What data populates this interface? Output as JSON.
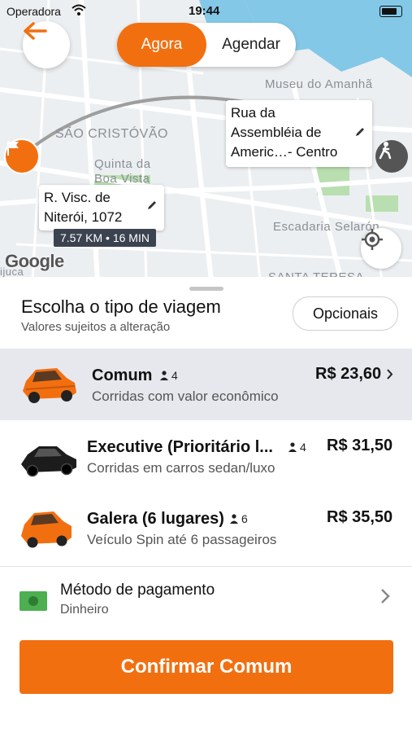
{
  "status": {
    "carrier": "Operadora",
    "time": "19:44"
  },
  "header": {
    "toggle_now": "Agora",
    "toggle_schedule": "Agendar"
  },
  "map": {
    "labels": {
      "museum": "Museu do Amanhã",
      "district": "SÃO CRISTÓVÃO",
      "quinta1": "Quinta da",
      "quinta2": "Boa Vista",
      "escadaria": "Escadaria Selarón",
      "santa_teresa": "SANTA TERESA",
      "tijuca": "ijuca"
    },
    "origin": {
      "line1": "R. Visc. de",
      "line2": "Niterói, 1072"
    },
    "destination": {
      "line1": "Rua da",
      "line2": "Assembléia de",
      "line3": "Americ…- Centro"
    },
    "eta": "7.57 KM • 16 MIN",
    "attribution": "Google"
  },
  "sheet": {
    "title": "Escolha o tipo de viagem",
    "subtitle": "Valores sujeitos a alteração",
    "options_label": "Opcionais"
  },
  "rides": [
    {
      "name": "Comum",
      "seats": "4",
      "desc": "Corridas com valor econômico",
      "price": "R$ 23,60",
      "color": "#f26f10"
    },
    {
      "name": "Executive (Prioritário l...",
      "seats": "4",
      "desc": "Corridas em carros sedan/luxo",
      "price": "R$ 31,50",
      "color": "#1c1c1c"
    },
    {
      "name": "Galera (6 lugares)",
      "seats": "6",
      "desc": "Veículo Spin até 6 passageiros",
      "price": "R$ 35,50",
      "color": "#f26f10"
    }
  ],
  "payment": {
    "title": "Método de pagamento",
    "value": "Dinheiro"
  },
  "confirm_label": "Confirmar Comum",
  "colors": {
    "accent": "#f26f10",
    "water": "#84c8e8",
    "park": "#b9dfb0",
    "selected_row": "#e6e8ee"
  }
}
